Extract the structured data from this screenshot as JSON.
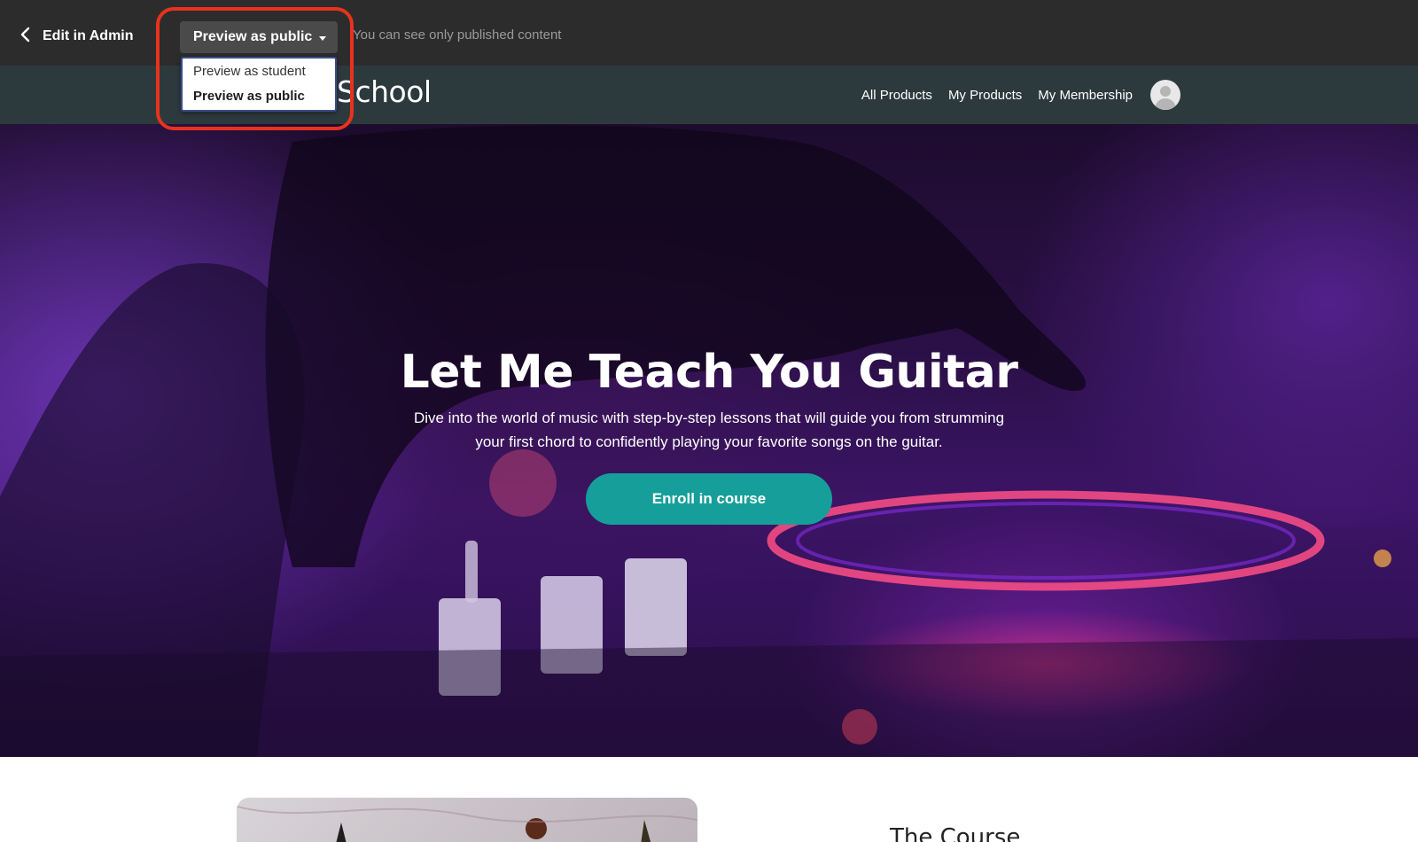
{
  "admin_bar": {
    "back_label": "Edit in Admin",
    "preview_select": {
      "selected": "Preview as public",
      "options": [
        "Preview as student",
        "Preview as public"
      ]
    },
    "note": "You can see only published content"
  },
  "site_header": {
    "logo_text": "School",
    "nav": [
      "All Products",
      "My Products",
      "My Membership"
    ]
  },
  "hero": {
    "title": "Let Me Teach You Guitar",
    "subtitle": "Dive into the world of music with step-by-step lessons that will guide you from strumming your first chord to confidently playing your favorite songs on the guitar.",
    "cta_label": "Enroll in course"
  },
  "course_section": {
    "heading": "The Course"
  },
  "colors": {
    "admin_bar_bg": "#2c2c2c",
    "header_bg": "#2d3a3d",
    "cta": "#169f9a",
    "highlight": "#e8321e"
  }
}
